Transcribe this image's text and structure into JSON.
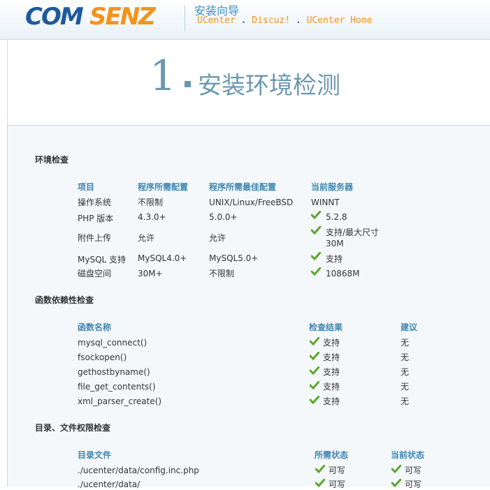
{
  "header": {
    "logo_text": "COMSENZ",
    "wizard_title": "安装向导",
    "products": [
      "UCenter",
      "Discuz!",
      "UCenter Home"
    ],
    "sep1": ".",
    "sep2": "."
  },
  "step": {
    "number": "1",
    "title": "安装环境检测"
  },
  "env": {
    "title": "环境检查",
    "headers": [
      "项目",
      "程序所需配置",
      "程序所需最佳配置",
      "当前服务器"
    ],
    "rows": [
      {
        "item": "操作系统",
        "required": "不限制",
        "best": "UNIX/Linux/FreeBSD",
        "current": "WINNT",
        "ok": false
      },
      {
        "item": "PHP 版本",
        "required": "4.3.0+",
        "best": "5.0.0+",
        "current": "5.2.8",
        "ok": true
      },
      {
        "item": "附件上传",
        "required": "允许",
        "best": "允许",
        "current": "支持/最大尺寸 30M",
        "ok": true
      },
      {
        "item": "MySQL 支持",
        "required": "MySQL4.0+",
        "best": "MySQL5.0+",
        "current": "支持",
        "ok": true
      },
      {
        "item": "磁盘空间",
        "required": "30M+",
        "best": "不限制",
        "current": "10868M",
        "ok": true
      }
    ]
  },
  "func": {
    "title": "函数依赖性检查",
    "headers": [
      "函数名称",
      "检查结果",
      "建议"
    ],
    "rows": [
      {
        "name": "mysql_connect()",
        "result": "支持",
        "advice": "无"
      },
      {
        "name": "fsockopen()",
        "result": "支持",
        "advice": "无"
      },
      {
        "name": "gethostbyname()",
        "result": "支持",
        "advice": "无"
      },
      {
        "name": "file_get_contents()",
        "result": "支持",
        "advice": "无"
      },
      {
        "name": "xml_parser_create()",
        "result": "支持",
        "advice": "无"
      }
    ]
  },
  "dir": {
    "title": "目录、文件权限检查",
    "headers": [
      "目录文件",
      "所需状态",
      "当前状态"
    ],
    "rows": [
      {
        "path": "./ucenter/data/config.inc.php",
        "required": "可写",
        "current": "可写"
      },
      {
        "path": "./ucenter/data/",
        "required": "可写",
        "current": "可写"
      }
    ]
  },
  "colors": {
    "accent": "#3e86b1",
    "check": "#5aa82a",
    "logo_blue": "#1f5a9e",
    "logo_orange": "#f3931b"
  }
}
